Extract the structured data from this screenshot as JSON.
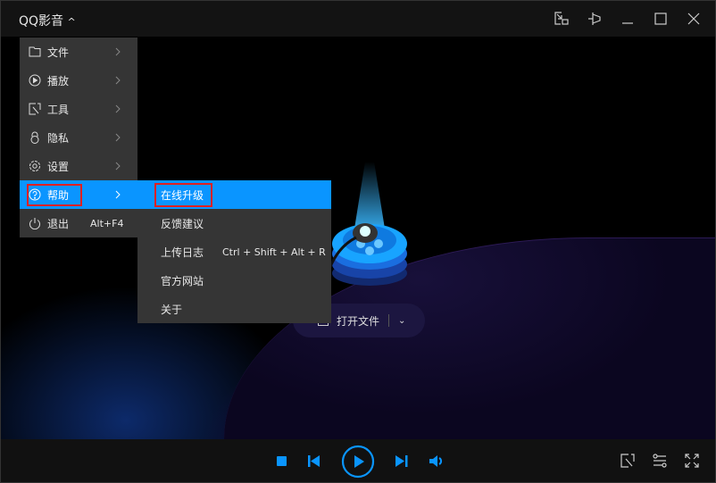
{
  "app": {
    "title": "QQ影音"
  },
  "main_menu": [
    {
      "label": "文件",
      "icon": "folder-icon"
    },
    {
      "label": "播放",
      "icon": "play-circle-icon"
    },
    {
      "label": "工具",
      "icon": "tools-icon"
    },
    {
      "label": "隐私",
      "icon": "lock-icon"
    },
    {
      "label": "设置",
      "icon": "gear-icon"
    },
    {
      "label": "帮助",
      "icon": "help-icon"
    },
    {
      "label": "退出",
      "icon": "power-icon",
      "shortcut": "Alt+F4"
    }
  ],
  "help_submenu": [
    {
      "label": "在线升级"
    },
    {
      "label": "反馈建议"
    },
    {
      "label": "上传日志",
      "shortcut": "Ctrl + Shift + Alt + R"
    },
    {
      "label": "官方网站"
    },
    {
      "label": "关于"
    }
  ],
  "stage": {
    "open_file_label": "打开文件"
  },
  "colors": {
    "accent": "#0a95ff",
    "highlight_box": "#e02020"
  }
}
